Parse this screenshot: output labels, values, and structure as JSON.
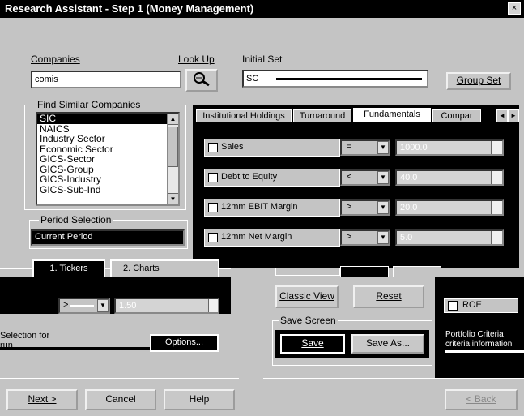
{
  "window": {
    "title": "Research Assistant - Step 1  (Money Management)",
    "close_glyph": "×"
  },
  "companies": {
    "label": "Companies",
    "value": "comis",
    "lookup_label": "Look Up",
    "initial_set_label": "Initial Set",
    "initial_set_value": "SC",
    "group_set_label": "Group Set"
  },
  "find_similar": {
    "legend": "Find Similar Companies",
    "items": [
      "SIC",
      "NAICS",
      "Industry Sector",
      "Economic Sector",
      "GICS-Sector",
      "GICS-Group",
      "GICS-Industry",
      "GICS-Sub-Ind"
    ],
    "selected_index": 0
  },
  "period": {
    "legend": "Period Selection",
    "value": "Current Period"
  },
  "tabs": [
    {
      "label": "Institutional Holdings",
      "active": false
    },
    {
      "label": "Turnaround",
      "active": false
    },
    {
      "label": "Fundamentals",
      "active": true
    },
    {
      "label": "Compar",
      "active": false
    }
  ],
  "criteria": [
    {
      "label": "Sales",
      "operator": "=",
      "value": "1000.0"
    },
    {
      "label": "Debt to Equity",
      "operator": "<",
      "value": "40.0"
    },
    {
      "label": "12mm EBIT Margin",
      "operator": ">",
      "value": "20.0"
    },
    {
      "label": "12mm Net Margin",
      "operator": ">",
      "value": "5.0"
    }
  ],
  "lower_left": {
    "tab1": "1. Tickers",
    "tab2": "2. Charts",
    "combo_value": ">",
    "spin_value": "1.50",
    "text1": "Selection for",
    "text2": "run",
    "options_label": "Options..."
  },
  "view_buttons": {
    "classic_view": "Classic View",
    "reset": "Reset"
  },
  "save_screen": {
    "legend": "Save Screen",
    "save": "Save",
    "save_as": "Save As..."
  },
  "right_panel": {
    "roe_label": "ROE",
    "filter_text1": "Portfolio Criteria",
    "filter_text2": "criteria information"
  },
  "footer": {
    "next": "Next >",
    "cancel": "Cancel",
    "help": "Help",
    "back": "< Back"
  },
  "icons": {
    "lookup": "magnifier-icon",
    "combo_arrow": "▼",
    "scroll_up": "▲",
    "scroll_down": "▼",
    "spin_up": "▲",
    "spin_down": "▼",
    "tab_prev": "◄",
    "tab_next": "►"
  }
}
